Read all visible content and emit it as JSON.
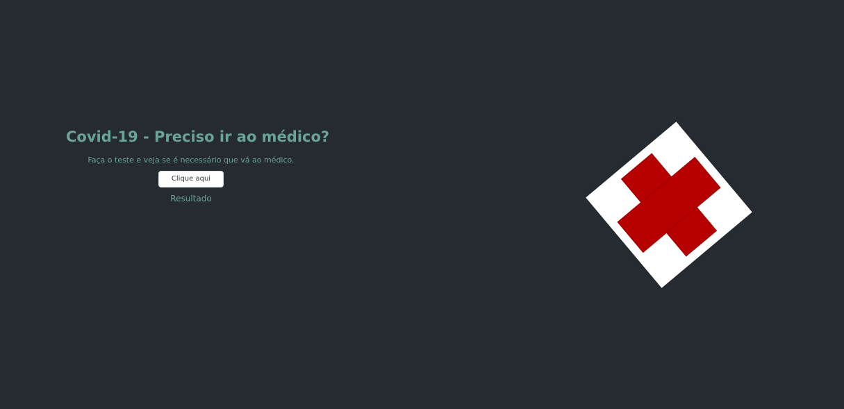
{
  "header": {
    "title": "Covid-19 - Preciso ir ao médico?",
    "subtitle": "Faça o teste e veja se é necessário que vá ao médico."
  },
  "actions": {
    "start_button_label": "Clique aqui",
    "result_label": "Resultado"
  },
  "illustration": {
    "icon": "red-cross-icon",
    "cross_color": "#b70000",
    "card_color": "#ffffff"
  },
  "theme": {
    "background": "#262b32",
    "accent_text": "#6aa39a"
  }
}
